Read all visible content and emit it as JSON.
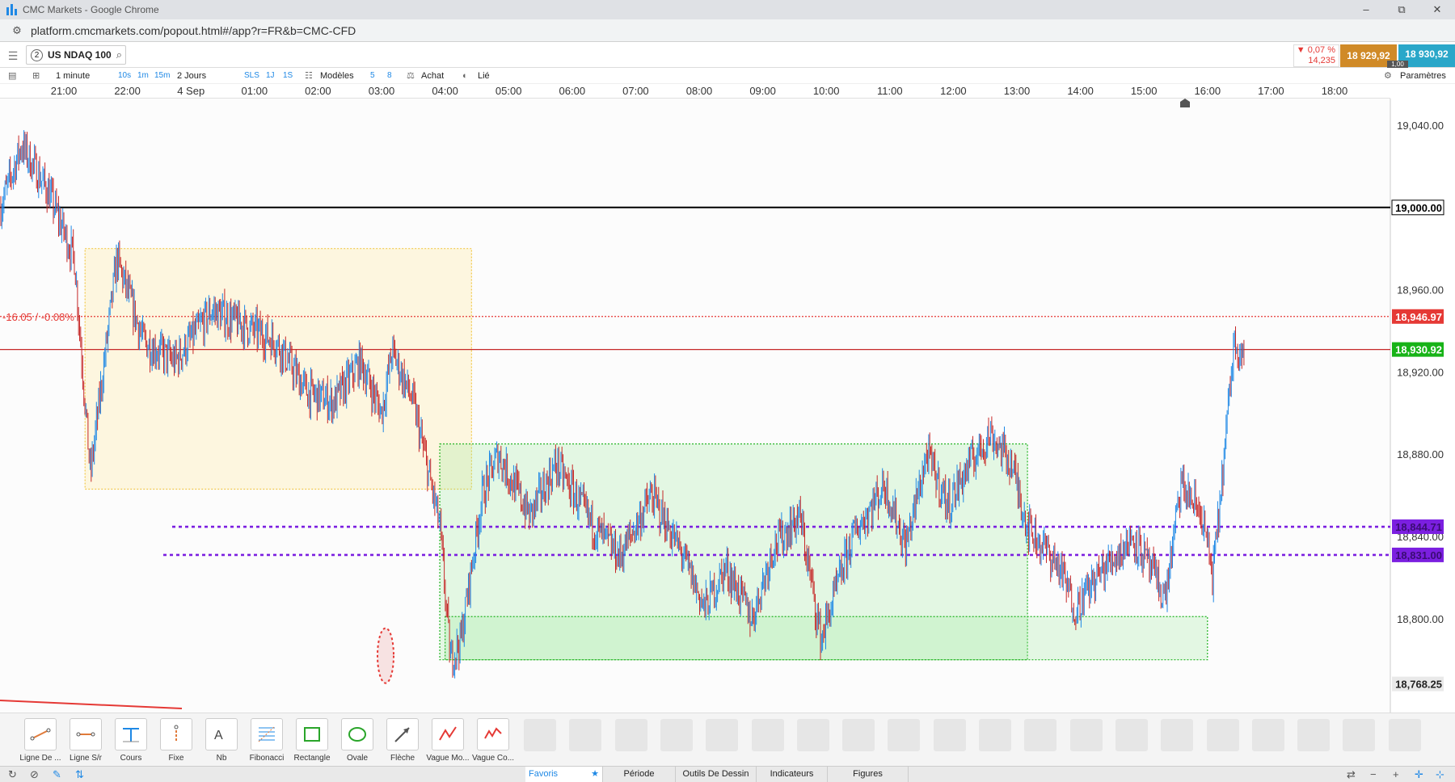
{
  "window": {
    "title": "CMC Markets - Google Chrome",
    "minimize": "–",
    "restore": "⧉",
    "close": "✕"
  },
  "address": {
    "url": "platform.cmcmarkets.com/popout.html#/app?r=FR&b=CMC-CFD"
  },
  "instrument": {
    "tab_number": "2",
    "name": "US NDAQ 100",
    "change_pct": "▼ 0,07 %",
    "change_pts": "14,235",
    "sell": "18 929,92",
    "buy": "18 930,92",
    "spread": "1,00"
  },
  "toolbar": {
    "interval": "1 minute",
    "quick_intervals": [
      "10s",
      "1m",
      "15m"
    ],
    "range": "2 Jours",
    "quick_ranges": [
      "SLS",
      "1J",
      "1S"
    ],
    "models": "Modèles",
    "count_a": "5",
    "count_b": "8",
    "buy": "Achat",
    "linked": "Lié",
    "settings": "Paramètres"
  },
  "time_axis": [
    "21:00",
    "22:00",
    "4 Sep",
    "01:00",
    "02:00",
    "03:00",
    "04:00",
    "05:00",
    "06:00",
    "07:00",
    "08:00",
    "09:00",
    "10:00",
    "11:00",
    "12:00",
    "13:00",
    "14:00",
    "15:00",
    "16:00",
    "17:00",
    "18:00"
  ],
  "chart_data": {
    "type": "candlestick",
    "instrument": "US NDAQ 100",
    "interval": "1 minute",
    "price_ticks": [
      19040,
      19000,
      18960,
      18920,
      18880,
      18840,
      18800
    ],
    "price_tick_labels": [
      "19,040.00",
      "19,000.00",
      "18,960.00",
      "18,920.00",
      "18,880.00",
      "18,840.00",
      "18,800.00"
    ],
    "ylim": [
      18760,
      19065
    ],
    "colors": {
      "up": "#1e88e5",
      "down": "#c62828",
      "purple": "#7b1fe0",
      "red": "#e53935",
      "green": "#17b317",
      "black": "#000000"
    },
    "horizontal_lines": [
      {
        "price": 19000.0,
        "label": "19,000.00",
        "color": "#000000",
        "style": "solid"
      },
      {
        "price": 18946.97,
        "label": "18,946.97",
        "color": "#e53935",
        "style": "dotted"
      },
      {
        "price": 18930.92,
        "label": "18,930.92",
        "color": "#c62828",
        "style": "solid"
      },
      {
        "price": 18844.71,
        "label": "18,844.71",
        "color": "#7b1fe0",
        "style": "dashed"
      },
      {
        "price": 18831.0,
        "label": "18,831.00",
        "color": "#7b1fe0",
        "style": "dashed"
      }
    ],
    "low_label": "18,768.25",
    "change_annotation": "-16.05 / -0.08%",
    "zones": [
      {
        "time_from": "21:20",
        "time_to": "03:25",
        "price_top": 18980,
        "price_bottom": 18863,
        "color": "yellow"
      },
      {
        "time_from": "02:55",
        "time_to": "12:10",
        "price_top": 18885,
        "price_bottom": 18780,
        "color": "green"
      },
      {
        "time_from": "03:00",
        "time_to": "15:00",
        "price_top": 18801,
        "price_bottom": 18780,
        "color": "green"
      }
    ],
    "series": [
      {
        "time": "20:00",
        "price": 19000
      },
      {
        "time": "20:20",
        "price": 19030
      },
      {
        "time": "20:45",
        "price": 19008
      },
      {
        "time": "21:10",
        "price": 18975
      },
      {
        "time": "21:25",
        "price": 18870
      },
      {
        "time": "21:50",
        "price": 18975
      },
      {
        "time": "22:15",
        "price": 18935
      },
      {
        "time": "22:45",
        "price": 18925
      },
      {
        "time": "23:20",
        "price": 18950
      },
      {
        "time": "00:20",
        "price": 18935
      },
      {
        "time": "00:50",
        "price": 18910
      },
      {
        "time": "01:15",
        "price": 18905
      },
      {
        "time": "01:40",
        "price": 18925
      },
      {
        "time": "02:00",
        "price": 18900
      },
      {
        "time": "02:10",
        "price": 18930
      },
      {
        "time": "02:30",
        "price": 18905
      },
      {
        "time": "02:55",
        "price": 18845
      },
      {
        "time": "03:05",
        "price": 18780
      },
      {
        "time": "03:15",
        "price": 18790
      },
      {
        "time": "03:35",
        "price": 18860
      },
      {
        "time": "03:50",
        "price": 18880
      },
      {
        "time": "04:20",
        "price": 18850
      },
      {
        "time": "04:45",
        "price": 18875
      },
      {
        "time": "05:20",
        "price": 18845
      },
      {
        "time": "05:45",
        "price": 18830
      },
      {
        "time": "06:15",
        "price": 18860
      },
      {
        "time": "06:45",
        "price": 18830
      },
      {
        "time": "07:05",
        "price": 18805
      },
      {
        "time": "07:25",
        "price": 18825
      },
      {
        "time": "07:50",
        "price": 18800
      },
      {
        "time": "08:10",
        "price": 18835
      },
      {
        "time": "08:35",
        "price": 18850
      },
      {
        "time": "08:55",
        "price": 18790
      },
      {
        "time": "09:25",
        "price": 18840
      },
      {
        "time": "09:55",
        "price": 18865
      },
      {
        "time": "10:15",
        "price": 18835
      },
      {
        "time": "10:35",
        "price": 18880
      },
      {
        "time": "10:55",
        "price": 18855
      },
      {
        "time": "11:15",
        "price": 18875
      },
      {
        "time": "11:35",
        "price": 18890
      },
      {
        "time": "11:55",
        "price": 18875
      },
      {
        "time": "12:10",
        "price": 18845
      },
      {
        "time": "12:40",
        "price": 18825
      },
      {
        "time": "12:55",
        "price": 18805
      },
      {
        "time": "13:15",
        "price": 18820
      },
      {
        "time": "13:50",
        "price": 18840
      },
      {
        "time": "14:20",
        "price": 18810
      },
      {
        "time": "14:35",
        "price": 18865
      },
      {
        "time": "14:55",
        "price": 18850
      },
      {
        "time": "15:05",
        "price": 18820
      },
      {
        "time": "15:15",
        "price": 18875
      },
      {
        "time": "15:25",
        "price": 18935
      },
      {
        "time": "15:35",
        "price": 18930
      }
    ]
  },
  "tools": [
    {
      "label": "Ligne De ...",
      "icon": "trend-line-icon"
    },
    {
      "label": "Ligne S/r",
      "icon": "sr-line-icon"
    },
    {
      "label": "Cours",
      "icon": "price-icon"
    },
    {
      "label": "Fixe",
      "icon": "fixed-icon"
    },
    {
      "label": "Nb",
      "icon": "text-icon"
    },
    {
      "label": "Fibonacci",
      "icon": "fibonacci-icon"
    },
    {
      "label": "Rectangle",
      "icon": "rectangle-icon"
    },
    {
      "label": "Ovale",
      "icon": "oval-icon"
    },
    {
      "label": "Flèche",
      "icon": "arrow-icon"
    },
    {
      "label": "Vague Mo...",
      "icon": "wave-icon"
    },
    {
      "label": "Vague Co...",
      "icon": "wave-c-icon"
    }
  ],
  "bottom_tabs": {
    "favorites": "Favoris",
    "period": "Période",
    "drawing": "Outils De Dessin",
    "indicators": "Indicateurs",
    "figures": "Figures"
  }
}
